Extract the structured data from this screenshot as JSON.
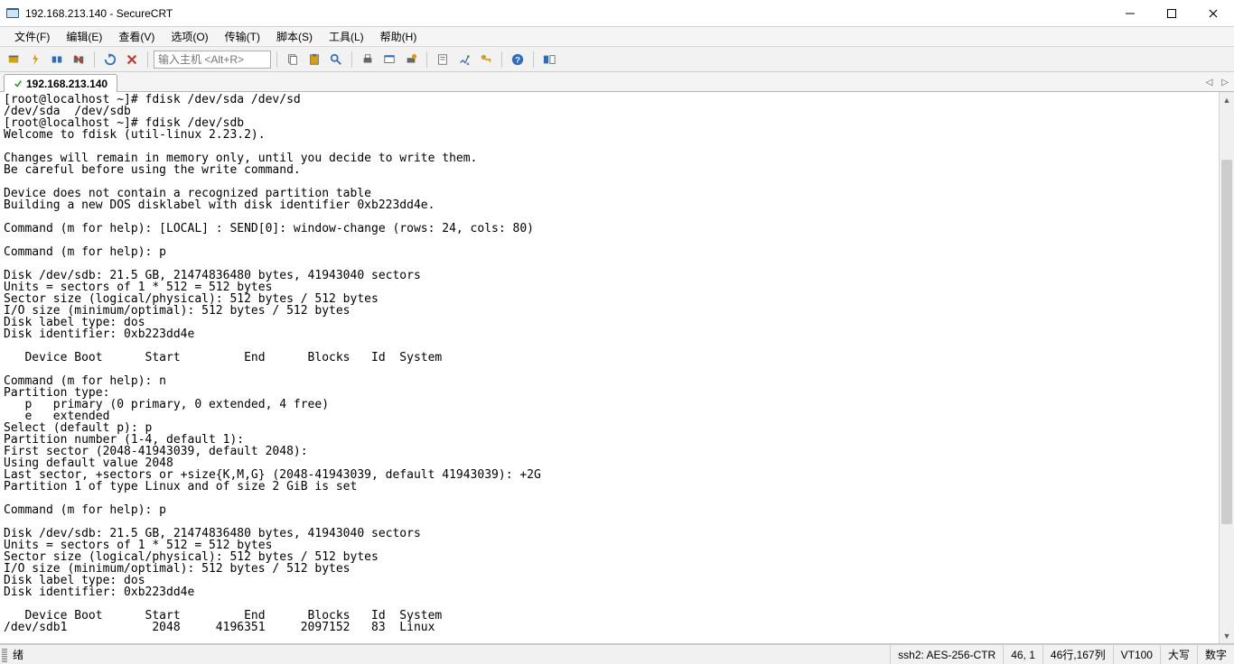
{
  "window": {
    "title": "192.168.213.140 - SecureCRT"
  },
  "menu": {
    "file": "文件(F)",
    "edit": "编辑(E)",
    "view": "查看(V)",
    "options": "选项(O)",
    "transfer": "传输(T)",
    "script": "脚本(S)",
    "tools": "工具(L)",
    "help": "帮助(H)"
  },
  "toolbar": {
    "host_placeholder": "输入主机 <Alt+R>"
  },
  "tabs": {
    "active_label": "192.168.213.140"
  },
  "terminal": {
    "content": "[root@localhost ~]# fdisk /dev/sda /dev/sd\n/dev/sda  /dev/sdb\n[root@localhost ~]# fdisk /dev/sdb\nWelcome to fdisk (util-linux 2.23.2).\n\nChanges will remain in memory only, until you decide to write them.\nBe careful before using the write command.\n\nDevice does not contain a recognized partition table\nBuilding a new DOS disklabel with disk identifier 0xb223dd4e.\n\nCommand (m for help): [LOCAL] : SEND[0]: window-change (rows: 24, cols: 80)\n\nCommand (m for help): p\n\nDisk /dev/sdb: 21.5 GB, 21474836480 bytes, 41943040 sectors\nUnits = sectors of 1 * 512 = 512 bytes\nSector size (logical/physical): 512 bytes / 512 bytes\nI/O size (minimum/optimal): 512 bytes / 512 bytes\nDisk label type: dos\nDisk identifier: 0xb223dd4e\n\n   Device Boot      Start         End      Blocks   Id  System\n\nCommand (m for help): n\nPartition type:\n   p   primary (0 primary, 0 extended, 4 free)\n   e   extended\nSelect (default p): p\nPartition number (1-4, default 1):\nFirst sector (2048-41943039, default 2048):\nUsing default value 2048\nLast sector, +sectors or +size{K,M,G} (2048-41943039, default 41943039): +2G\nPartition 1 of type Linux and of size 2 GiB is set\n\nCommand (m for help): p\n\nDisk /dev/sdb: 21.5 GB, 21474836480 bytes, 41943040 sectors\nUnits = sectors of 1 * 512 = 512 bytes\nSector size (logical/physical): 512 bytes / 512 bytes\nI/O size (minimum/optimal): 512 bytes / 512 bytes\nDisk label type: dos\nDisk identifier: 0xb223dd4e\n\n   Device Boot      Start         End      Blocks   Id  System\n/dev/sdb1            2048     4196351     2097152   83  Linux"
  },
  "status": {
    "ready": "绪",
    "cipher": "ssh2: AES-256-CTR",
    "cursor": "46,  1",
    "size": "46行,167列",
    "term": "VT100",
    "caps": "大写",
    "num": "数字"
  }
}
